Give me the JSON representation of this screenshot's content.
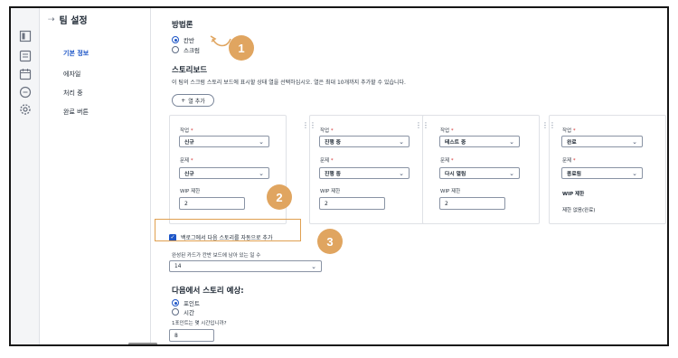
{
  "window": {
    "title": "팀 설정"
  },
  "rail_icons": [
    "board-icon",
    "list-icon",
    "calendar-icon",
    "chat-icon",
    "settings-icon"
  ],
  "nav": [
    {
      "label": "기본 정보",
      "active": true
    },
    {
      "label": "에자일",
      "active": false
    },
    {
      "label": "처리 중",
      "active": false
    },
    {
      "label": "완료 버튼",
      "active": false
    }
  ],
  "methodology": {
    "title": "방법론",
    "options": [
      {
        "label": "칸반",
        "checked": true
      },
      {
        "label": "스크럼",
        "checked": false
      }
    ]
  },
  "story_board": {
    "title": "스토리보드",
    "description": "이 팀의 스크럼 스토리 보드에 표시할 상태 열을 선택하십시오. 열은 최대 10개까지 추가할 수 있습니다.",
    "add_column_label": "열 추가",
    "add_icon": "plus-icon",
    "columns": [
      {
        "work_label": "작업",
        "work_value": "신규",
        "issue_label": "문제",
        "issue_value": "신규",
        "wip_label": "WIP 제한",
        "wip_value": "2"
      },
      {
        "work_label": "작업",
        "work_value": "진행 중",
        "issue_label": "문제",
        "issue_value": "진행 중",
        "wip_label": "WIP 제한",
        "wip_value": "2"
      },
      {
        "work_label": "작업",
        "work_value": "테스트 중",
        "issue_label": "문제",
        "issue_value": "다시 열림",
        "wip_label": "WIP 제한",
        "wip_value": "2"
      },
      {
        "work_label": "작업",
        "work_value": "완료",
        "issue_label": "문제",
        "issue_value": "종료됨",
        "wip_label": "WIP 제한",
        "wip_static": "제한 없음(완료)"
      }
    ]
  },
  "backlog": {
    "checkbox_label": "백로그에서 다음 스토리를 자동으로 추가",
    "checked": true,
    "days_label": "완성된 카드가 칸반 보드에 남아 있는 일 수",
    "days_value": "14"
  },
  "estimate": {
    "title": "다음에서 스토리 예상:",
    "options": [
      {
        "label": "포인트",
        "checked": true
      },
      {
        "label": "시간",
        "checked": false
      }
    ],
    "hours_label": "1포인트는 몇 시간입니까?",
    "hours_value": "8"
  },
  "annotations": [
    "1",
    "2",
    "3"
  ],
  "colors": {
    "accent": "#1e56c7",
    "annotation": "#e0a560",
    "required": "#d32f2f"
  }
}
